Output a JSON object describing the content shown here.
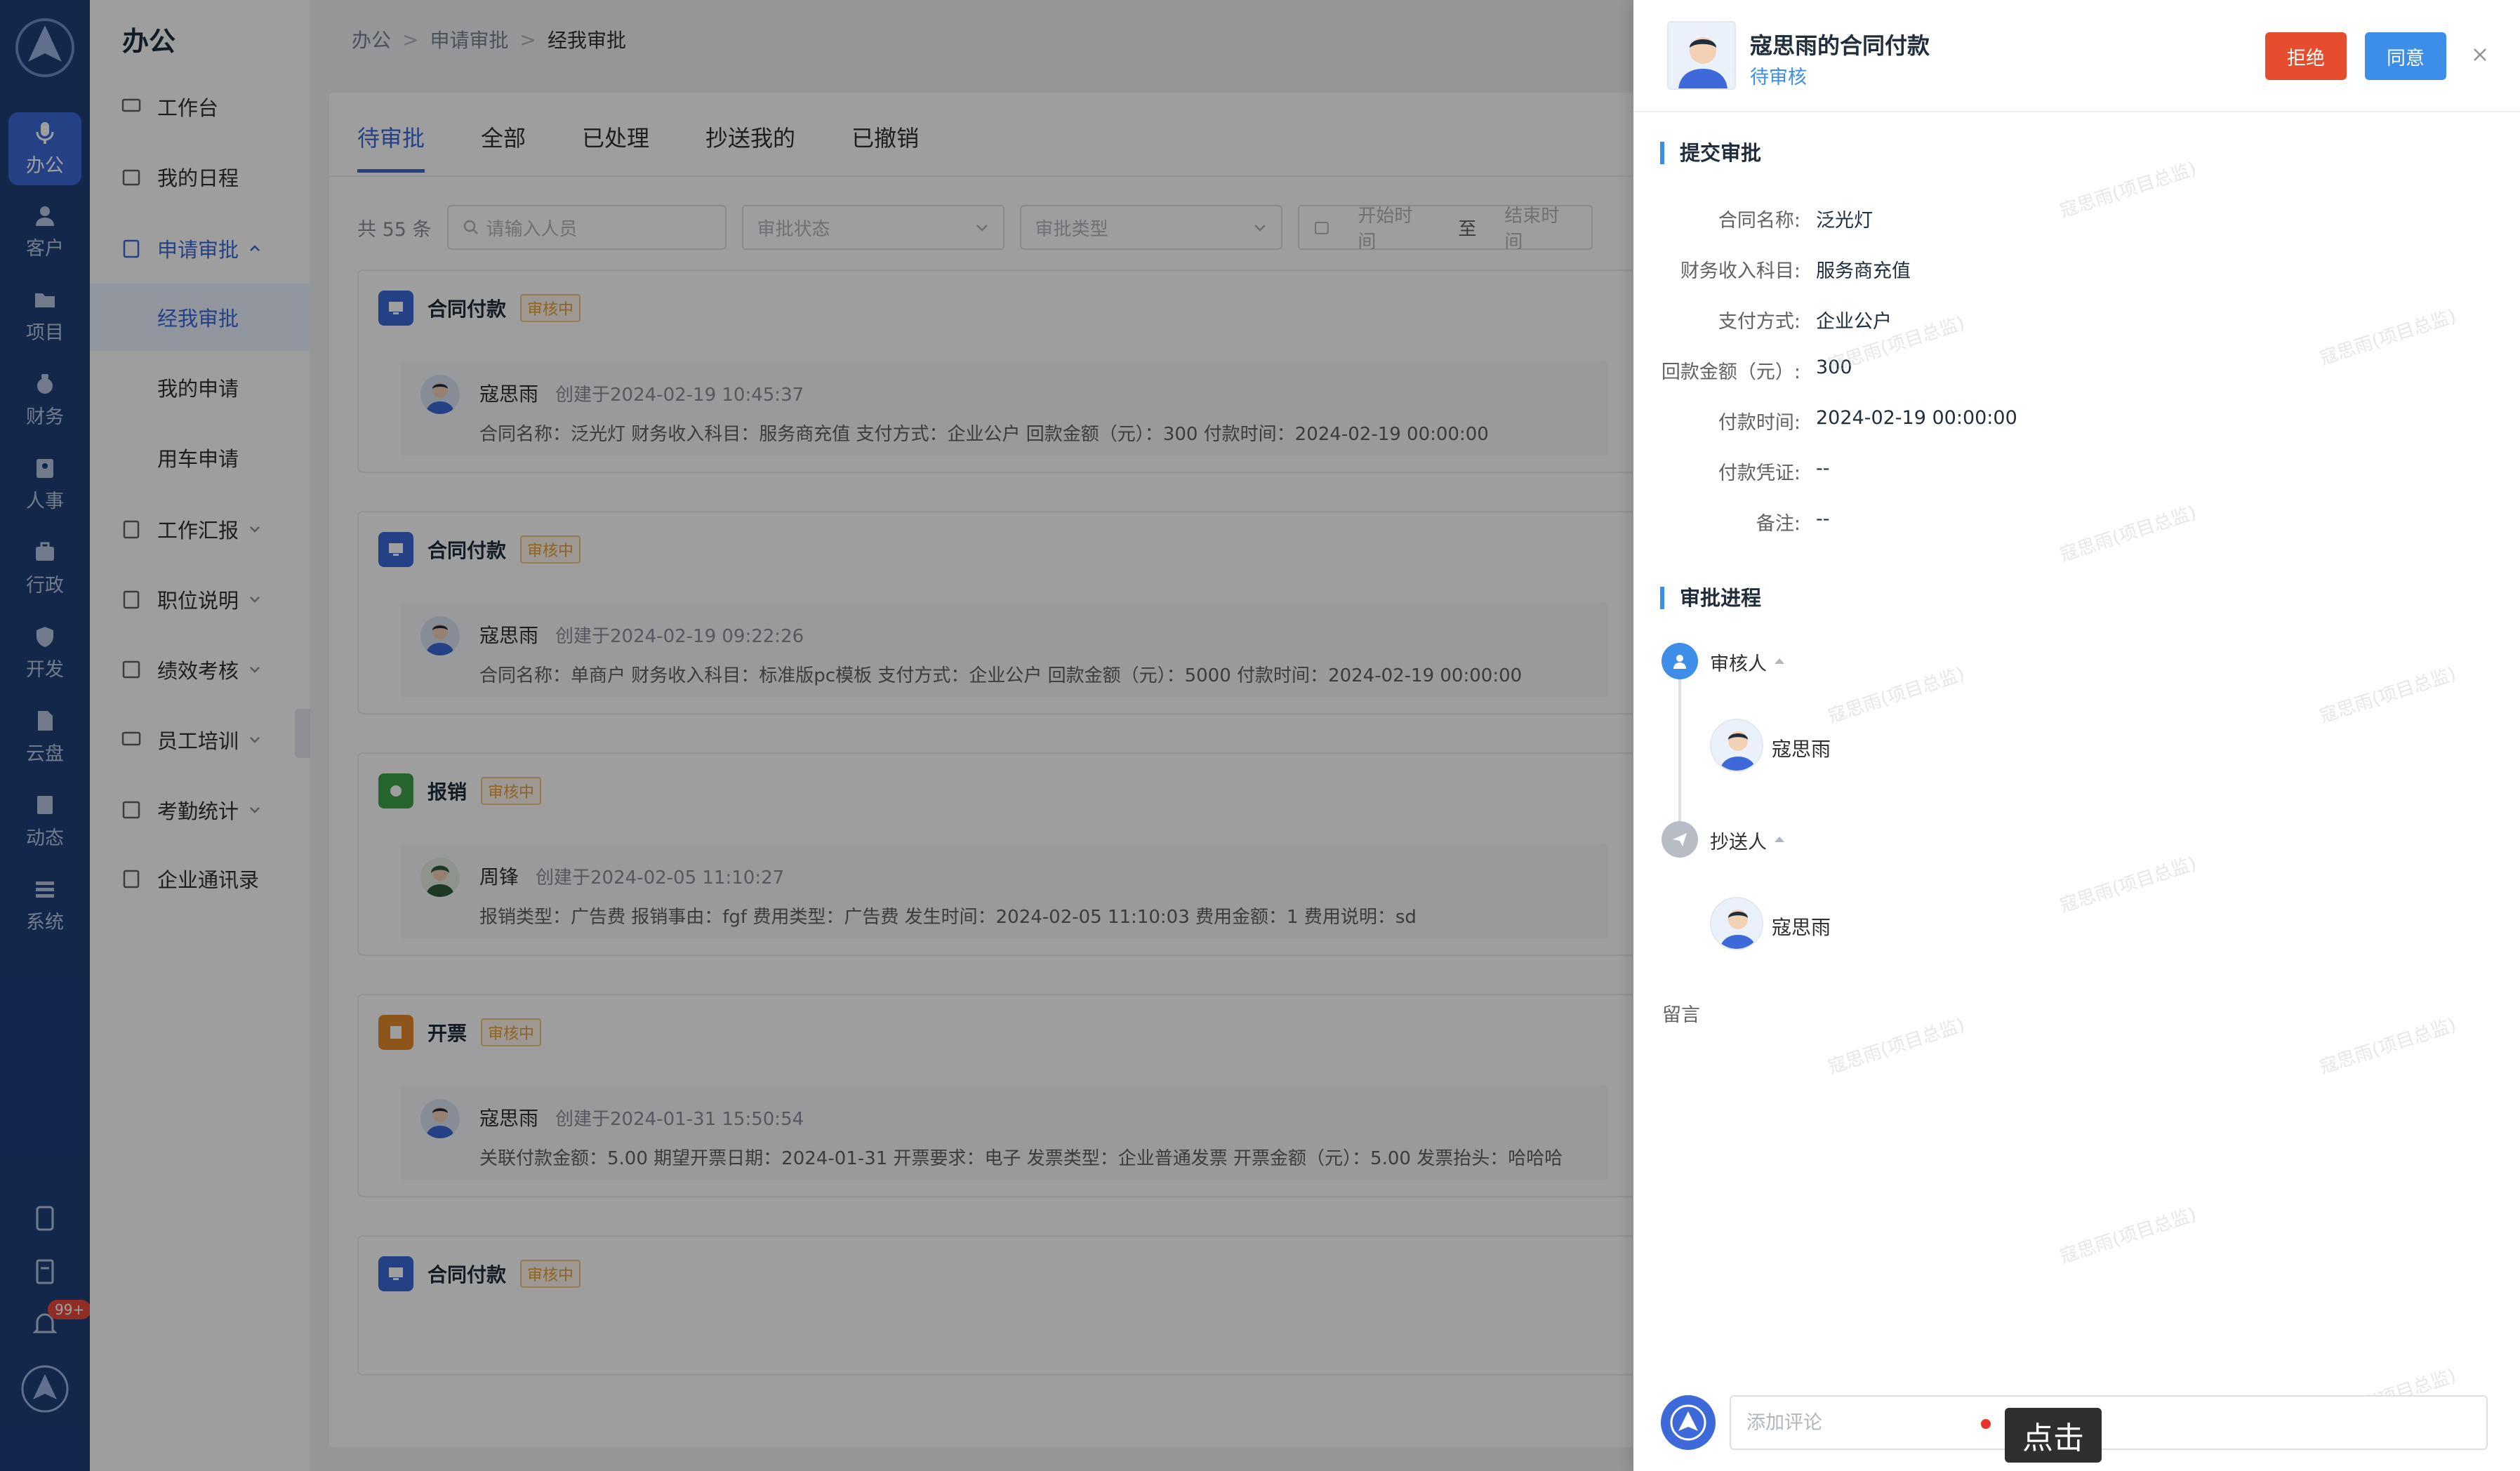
{
  "rail": {
    "items": [
      {
        "label": "办公",
        "icon": "mic-icon"
      },
      {
        "label": "客户",
        "icon": "user-icon"
      },
      {
        "label": "项目",
        "icon": "folder-icon"
      },
      {
        "label": "财务",
        "icon": "money-bag-icon"
      },
      {
        "label": "人事",
        "icon": "id-card-icon"
      },
      {
        "label": "行政",
        "icon": "briefcase-icon"
      },
      {
        "label": "开发",
        "icon": "shield-icon"
      },
      {
        "label": "云盘",
        "icon": "cloud-file-icon"
      },
      {
        "label": "动态",
        "icon": "feed-icon"
      },
      {
        "label": "系统",
        "icon": "settings-icon"
      }
    ],
    "notification_count": "99+"
  },
  "subnav": {
    "title": "办公",
    "items": [
      {
        "label": "工作台"
      },
      {
        "label": "我的日程"
      },
      {
        "label": "申请审批"
      },
      {
        "label": "经我审批"
      },
      {
        "label": "我的申请"
      },
      {
        "label": "用车申请"
      },
      {
        "label": "工作汇报"
      },
      {
        "label": "职位说明"
      },
      {
        "label": "绩效考核"
      },
      {
        "label": "员工培训"
      },
      {
        "label": "考勤统计"
      },
      {
        "label": "企业通讯录"
      }
    ]
  },
  "breadcrumb": [
    "办公",
    "申请审批",
    "经我审批"
  ],
  "tabs": [
    "待审批",
    "全部",
    "已处理",
    "抄送我的",
    "已撤销"
  ],
  "filters": {
    "total": "共 55 条",
    "search_placeholder": "请输入人员",
    "status_placeholder": "审批状态",
    "type_placeholder": "审批类型",
    "start_placeholder": "开始时间",
    "range_sep": "至",
    "end_placeholder": "结束时间"
  },
  "cards": [
    {
      "type": "合同付款",
      "tag": "审核中",
      "icon_color": "#3d6ad8",
      "name": "寇思雨",
      "time": "创建于2024-02-19 10:45:37",
      "detail": "合同名称：泛光灯   财务收入科目：服务商充值   支付方式：企业公户   回款金额（元）：300   付款时间：2024-02-19 00:00:00"
    },
    {
      "type": "合同付款",
      "tag": "审核中",
      "icon_color": "#3d6ad8",
      "name": "寇思雨",
      "time": "创建于2024-02-19 09:22:26",
      "detail": "合同名称：单商户   财务收入科目：标准版pc模板   支付方式：企业公户   回款金额（元）：5000   付款时间：2024-02-19 00:00:00"
    },
    {
      "type": "报销",
      "tag": "审核中",
      "icon_color": "#3fa34d",
      "name": "周锋",
      "time": "创建于2024-02-05 11:10:27",
      "detail": "报销类型：广告费   报销事由：fgf   费用类型：广告费   发生时间：2024-02-05 11:10:03   费用金额：1   费用说明：sd"
    },
    {
      "type": "开票",
      "tag": "审核中",
      "icon_color": "#e6892c",
      "name": "寇思雨",
      "time": "创建于2024-01-31 15:50:54",
      "detail": "关联付款金额：5.00   期望开票日期：2024-01-31   开票要求：电子   发票类型：企业普通发票   开票金额（元）：5.00   发票抬头：哈哈哈"
    },
    {
      "type": "合同付款",
      "tag": "审核中",
      "icon_color": "#3d6ad8"
    }
  ],
  "drawer": {
    "title": "寇思雨的合同付款",
    "status": "待审核",
    "reject_label": "拒绝",
    "agree_label": "同意",
    "submit_section": "提交审批",
    "fields": [
      {
        "k": "合同名称:",
        "v": "泛光灯"
      },
      {
        "k": "财务收入科目:",
        "v": "服务商充值"
      },
      {
        "k": "支付方式:",
        "v": "企业公户"
      },
      {
        "k": "回款金额（元）:",
        "v": "300"
      },
      {
        "k": "付款时间:",
        "v": "2024-02-19 00:00:00"
      },
      {
        "k": "付款凭证:",
        "v": "--"
      },
      {
        "k": "备注:",
        "v": "--"
      }
    ],
    "process_section": "审批进程",
    "reviewer_label": "审核人",
    "reviewer_name": "寇思雨",
    "cc_label": "抄送人",
    "cc_name": "寇思雨",
    "note_label": "留言",
    "comment_placeholder": "添加评论"
  },
  "annotation": {
    "label": "点击"
  },
  "watermark": "寇思雨(项目总监)",
  "colors": {
    "primary": "#3d6ad8",
    "danger": "#e54d2e",
    "info": "#3d8ee8",
    "warning": "#e6a23c"
  }
}
